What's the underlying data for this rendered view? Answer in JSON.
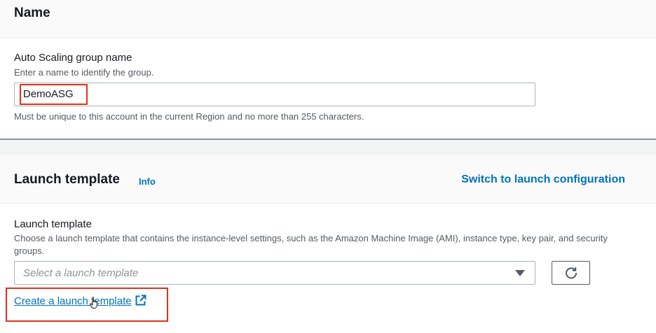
{
  "name_section": {
    "title": "Name",
    "field_label": "Auto Scaling group name",
    "field_description": "Enter a name to identify the group.",
    "input_value": "DemoASG",
    "constraint_text": "Must be unique to this account in the current Region and no more than 255 characters."
  },
  "launch_template_section": {
    "title": "Launch template",
    "info_link": "Info",
    "switch_link": "Switch to launch configuration",
    "field_label": "Launch template",
    "field_description": "Choose a launch template that contains the instance-level settings, such as the Amazon Machine Image (AMI), instance type, key pair, and security groups.",
    "select_placeholder": "Select a launch template",
    "create_link": "Create a launch template"
  },
  "icons": {
    "select_caret": "caret-down-icon",
    "refresh": "refresh-icon",
    "external_link": "external-link-icon",
    "cursor": "hand-pointer-icon"
  },
  "colors": {
    "link": "#0073bb",
    "highlight": "#e0321c",
    "header_bg": "#fafafa"
  }
}
